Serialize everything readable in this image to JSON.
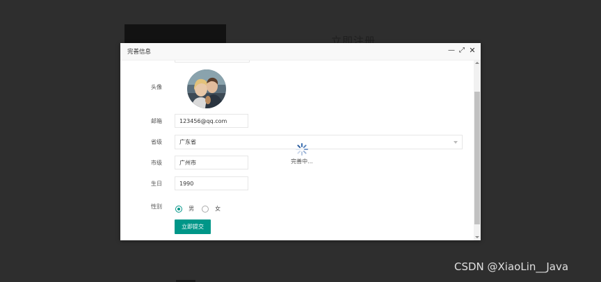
{
  "background": {
    "page_title": "立即注册"
  },
  "dialog": {
    "title": "完善信息",
    "controls": {
      "minimize": "—",
      "maximize": "⤢",
      "close": "✕"
    }
  },
  "form": {
    "avatar_label": "头像",
    "email_label": "邮箱",
    "email_value": "123456@qq.com",
    "province_label": "省级",
    "province_value": "广东省",
    "city_label": "市级",
    "city_value": "广州市",
    "birthday_label": "生日",
    "birthday_value": "1990",
    "gender_label": "性别",
    "gender_options": [
      {
        "label": "男",
        "checked": true
      },
      {
        "label": "女",
        "checked": false
      }
    ],
    "submit_label": "立即提交"
  },
  "loading": {
    "text": "完善中..."
  },
  "watermark": "CSDN @XiaoLin__Java",
  "colors": {
    "primary": "#009688",
    "overlay": "#2e2e2e"
  }
}
